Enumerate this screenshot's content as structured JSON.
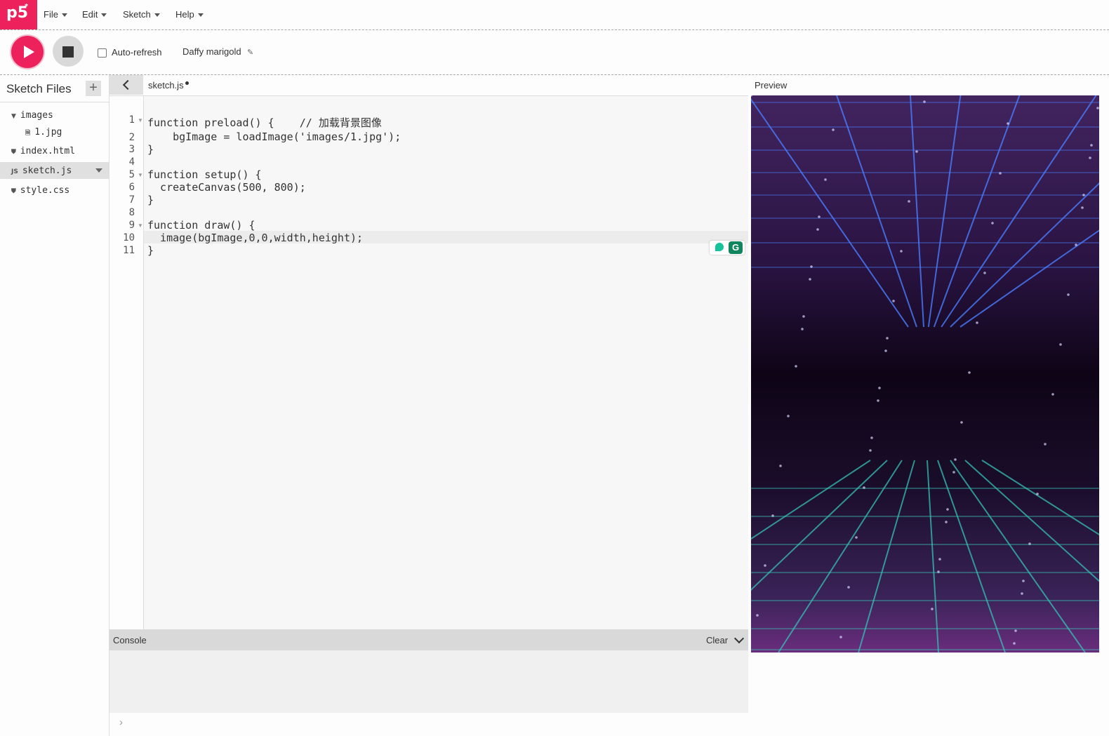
{
  "app": {
    "logo": "p5",
    "logo_sup": "*"
  },
  "menu": [
    {
      "label": "File"
    },
    {
      "label": "Edit"
    },
    {
      "label": "Sketch"
    },
    {
      "label": "Help"
    }
  ],
  "toolbar": {
    "auto_refresh_label": "Auto-refresh",
    "auto_refresh_checked": false,
    "sketch_name": "Daffy marigold"
  },
  "sidebar": {
    "title": "Sketch Files",
    "files": [
      {
        "name": "images",
        "type": "folder"
      },
      {
        "name": "1.jpg",
        "type": "file"
      },
      {
        "name": "index.html",
        "type": "html"
      },
      {
        "name": "sketch.js",
        "type": "js",
        "selected": true
      },
      {
        "name": "style.css",
        "type": "css"
      }
    ],
    "icons": {
      "folder": "▼",
      "file": "🗎",
      "js": "JS",
      "html": "⛊",
      "css": "⛊"
    }
  },
  "editor": {
    "tab_name": "sketch.js",
    "unsaved": true,
    "active_line": 10,
    "line_numbers": [
      "1",
      "2",
      "3",
      "4",
      "5",
      "6",
      "7",
      "8",
      "9",
      "10",
      "11"
    ],
    "code_lines": [
      "function preload() {    // 加载背景图像",
      "    bgImage = loadImage('images/1.jpg');",
      "}",
      "",
      "function setup() {",
      "  createCanvas(500, 800);",
      "}",
      "",
      "function draw() {",
      "  image(bgImage,0,0,width,height);",
      "}"
    ]
  },
  "console": {
    "title": "Console",
    "clear_label": "Clear",
    "prompt": "›"
  },
  "preview": {
    "title": "Preview",
    "gridline_color": "#4a7dff",
    "floor_line_color": "#36c2b4"
  },
  "colors": {
    "accent": "#ed225d"
  }
}
